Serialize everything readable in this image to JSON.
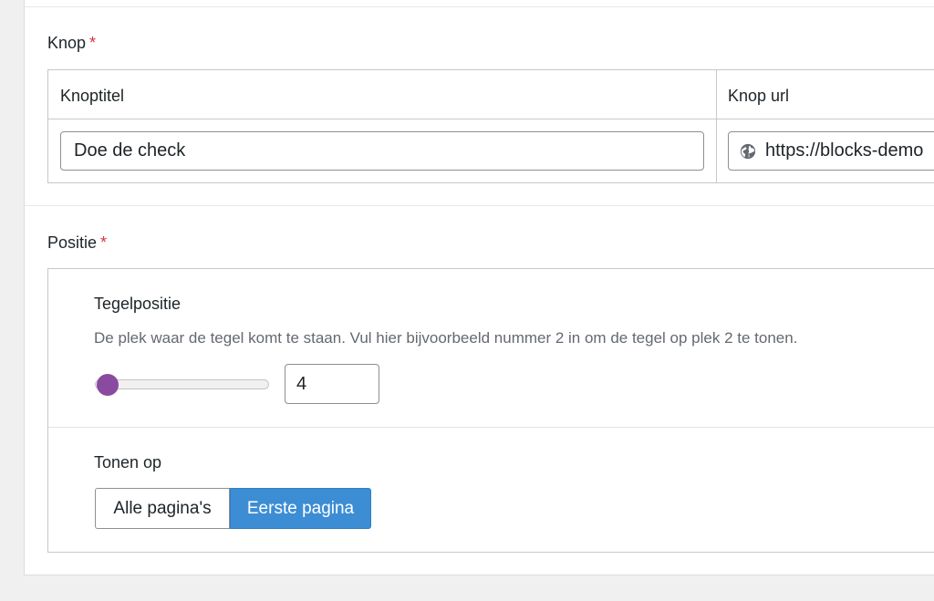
{
  "knop": {
    "label": "Knop",
    "required_mark": "*",
    "columns": {
      "title_header": "Knoptitel",
      "url_header": "Knop url"
    },
    "title_value": "Doe de check",
    "url_value": "https://blocks-demo"
  },
  "positie": {
    "label": "Positie",
    "required_mark": "*",
    "tile_position": {
      "label": "Tegelpositie",
      "description": "De plek waar de tegel komt te staan. Vul hier bijvoorbeeld nummer 2 in om de tegel op plek 2 te tonen.",
      "value": "4"
    },
    "show_on": {
      "label": "Tonen op",
      "options": [
        "Alle pagina's",
        "Eerste pagina"
      ],
      "selected": "Eerste pagina"
    }
  },
  "colors": {
    "required": "#d63638",
    "slider_thumb": "#8a4aa0",
    "toggle_active": "#3c8dd4"
  },
  "icons": {
    "url_icon": "globe-icon"
  }
}
